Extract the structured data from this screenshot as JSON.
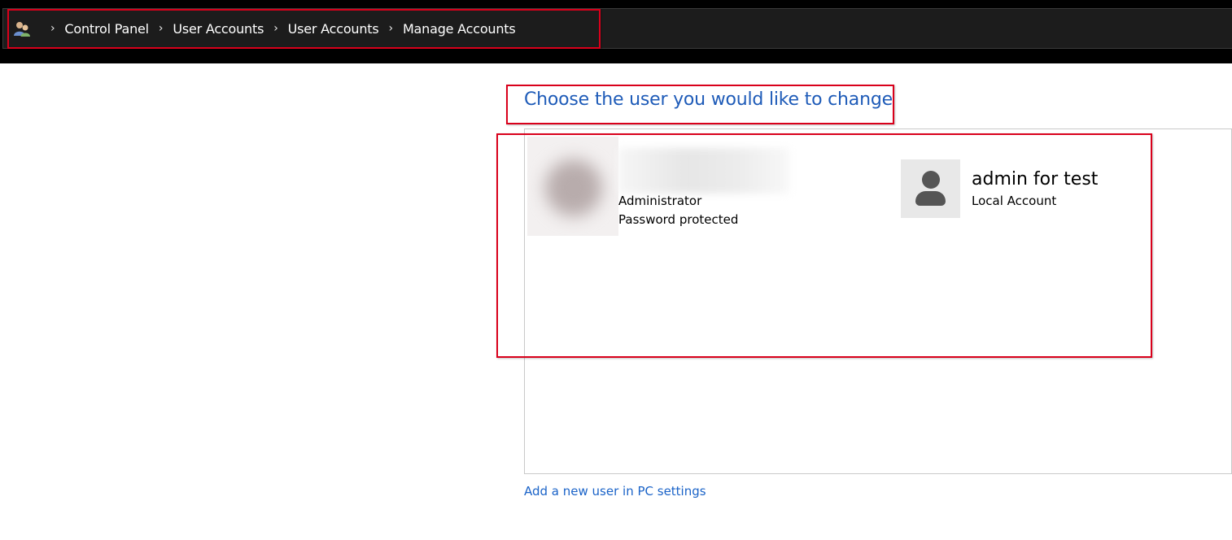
{
  "breadcrumb": {
    "icon": "users-icon",
    "separator": "›",
    "items": [
      "Control Panel",
      "User Accounts",
      "User Accounts",
      "Manage Accounts"
    ]
  },
  "main": {
    "heading": "Choose the user you would like to change",
    "accounts": [
      {
        "name": "",
        "role": "Administrator",
        "status": "Password protected",
        "avatar": "blurred-profile-picture"
      },
      {
        "name": "admin for test",
        "type": "Local Account",
        "avatar": "default-user-icon"
      }
    ],
    "add_user_link": "Add a new user in PC settings"
  },
  "colors": {
    "highlight": "#d9001b",
    "heading": "#1e5bb8",
    "link": "#1a63c8",
    "topbar": "#000000"
  }
}
